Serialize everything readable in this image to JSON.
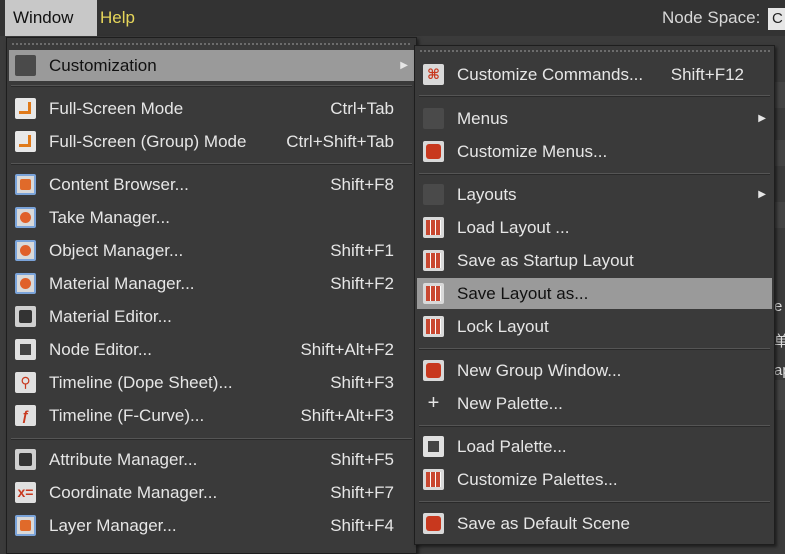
{
  "menubar": {
    "window_label": "Window",
    "help_label": "Help",
    "node_space_label": "Node Space:",
    "node_space_value": "C"
  },
  "background_fragments": [
    "e",
    "单",
    "ap"
  ],
  "window_menu": {
    "items": [
      {
        "label": "Customization",
        "shortcut": "",
        "icon": "blank-icon",
        "submenu": true,
        "highlighted": true
      },
      {
        "label": "Full-Screen Mode",
        "shortcut": "Ctrl+Tab",
        "icon": "fullscreen-icon"
      },
      {
        "label": "Full-Screen (Group) Mode",
        "shortcut": "Ctrl+Shift+Tab",
        "icon": "fullscreen-group-icon"
      },
      {
        "label": "Content Browser...",
        "shortcut": "Shift+F8",
        "icon": "content-browser-icon"
      },
      {
        "label": "Take Manager...",
        "shortcut": "",
        "icon": "take-manager-icon"
      },
      {
        "label": "Object Manager...",
        "shortcut": "Shift+F1",
        "icon": "object-manager-icon"
      },
      {
        "label": "Material Manager...",
        "shortcut": "Shift+F2",
        "icon": "material-manager-icon"
      },
      {
        "label": "Material Editor...",
        "shortcut": "",
        "icon": "material-editor-icon"
      },
      {
        "label": "Node Editor...",
        "shortcut": "Shift+Alt+F2",
        "icon": "node-editor-icon"
      },
      {
        "label": "Timeline (Dope Sheet)...",
        "shortcut": "Shift+F3",
        "icon": "timeline-dope-sheet-icon"
      },
      {
        "label": "Timeline (F-Curve)...",
        "shortcut": "Shift+Alt+F3",
        "icon": "timeline-fcurve-icon"
      },
      {
        "label": "Attribute Manager...",
        "shortcut": "Shift+F5",
        "icon": "attribute-manager-icon"
      },
      {
        "label": "Coordinate Manager...",
        "shortcut": "Shift+F7",
        "icon": "coordinate-manager-icon"
      },
      {
        "label": "Layer Manager...",
        "shortcut": "Shift+F4",
        "icon": "layer-manager-icon"
      }
    ]
  },
  "customization_menu": {
    "items": [
      {
        "label": "Customize Commands...",
        "shortcut": "Shift+F12",
        "icon": "customize-commands-icon"
      },
      {
        "label": "Menus",
        "shortcut": "",
        "icon": "blank-icon",
        "submenu": true
      },
      {
        "label": "Customize Menus...",
        "shortcut": "",
        "icon": "customize-menus-icon"
      },
      {
        "label": "Layouts",
        "shortcut": "",
        "icon": "blank-icon",
        "submenu": true
      },
      {
        "label": "Load Layout ...",
        "shortcut": "",
        "icon": "load-layout-icon"
      },
      {
        "label": "Save as Startup Layout",
        "shortcut": "",
        "icon": "save-startup-layout-icon"
      },
      {
        "label": "Save Layout as...",
        "shortcut": "",
        "icon": "save-layout-icon",
        "highlighted": true
      },
      {
        "label": "Lock Layout",
        "shortcut": "",
        "icon": "lock-layout-icon"
      },
      {
        "label": "New Group Window...",
        "shortcut": "",
        "icon": "new-group-window-icon"
      },
      {
        "label": "New Palette...",
        "shortcut": "",
        "icon": "new-palette-icon"
      },
      {
        "label": "Load Palette...",
        "shortcut": "",
        "icon": "load-palette-icon"
      },
      {
        "label": "Customize Palettes...",
        "shortcut": "",
        "icon": "customize-palettes-icon"
      },
      {
        "label": "Save as Default Scene",
        "shortcut": "",
        "icon": "save-default-scene-icon"
      }
    ]
  },
  "colors": {
    "menubar_bg": "#333333",
    "menu_bg": "#3a3a3a",
    "highlight": "#9a9a9a",
    "help_text": "#e6d65a",
    "icon_accent": "#c8381e"
  }
}
